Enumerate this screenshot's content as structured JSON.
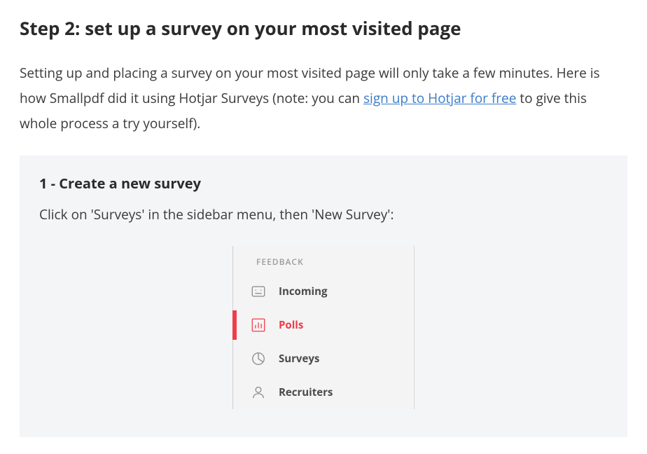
{
  "heading": "Step 2: set up a survey on your most visited page",
  "intro": {
    "part1": "Setting up and placing a survey on your most visited page will only take a few minutes. Here is how Smallpdf did it using Hotjar Surveys (note: you can ",
    "link_text": "sign up to Hotjar for free",
    "part2": " to give this whole process a try yourself)."
  },
  "substep": {
    "heading": "1 - Create a new survey",
    "text": "Click on 'Surveys' in the sidebar menu, then 'New Survey':"
  },
  "sidebar": {
    "section_label": "FEEDBACK",
    "items": [
      {
        "label": "Incoming"
      },
      {
        "label": "Polls"
      },
      {
        "label": "Surveys"
      },
      {
        "label": "Recruiters"
      }
    ]
  }
}
